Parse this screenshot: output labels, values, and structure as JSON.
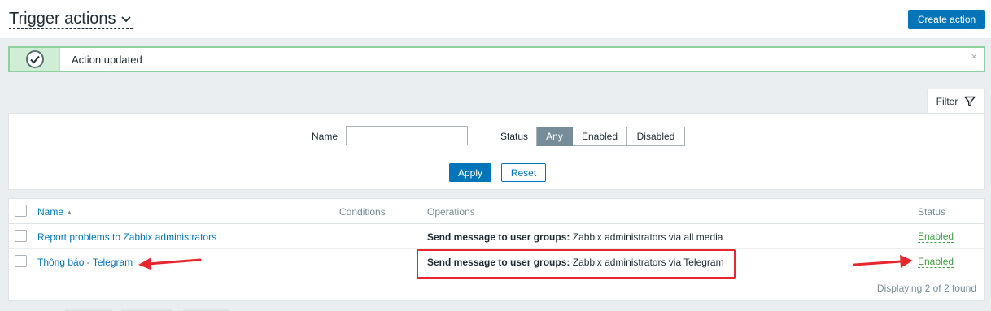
{
  "header": {
    "title": "Trigger actions",
    "create_button": "Create action"
  },
  "message": {
    "text": "Action updated",
    "close": "×"
  },
  "filter": {
    "tab_label": "Filter",
    "name_label": "Name",
    "name_value": "",
    "status_label": "Status",
    "status_options": [
      "Any",
      "Enabled",
      "Disabled"
    ],
    "status_selected": "Any",
    "apply": "Apply",
    "reset": "Reset"
  },
  "table": {
    "columns": {
      "name": "Name",
      "sort_indicator": "▲",
      "conditions": "Conditions",
      "operations": "Operations",
      "status": "Status"
    },
    "rows": [
      {
        "name": "Report problems to Zabbix administrators",
        "conditions": "",
        "operation_prefix": "Send message to user groups:",
        "operation_text": "Zabbix administrators via all media",
        "status": "Enabled"
      },
      {
        "name": "Thông báo - Telegram",
        "conditions": "",
        "operation_prefix": "Send message to user groups:",
        "operation_text": "Zabbix administrators via Telegram",
        "status": "Enabled"
      }
    ],
    "footer": "Displaying 2 of 2 found"
  },
  "colors": {
    "accent": "#0275b8",
    "success_border": "#8fd19e",
    "enabled": "#429e47",
    "annotation": "#e8262d"
  },
  "icons": [
    "chevron-down-icon",
    "check-circle-icon",
    "close-icon",
    "funnel-icon",
    "sort-asc-icon"
  ]
}
